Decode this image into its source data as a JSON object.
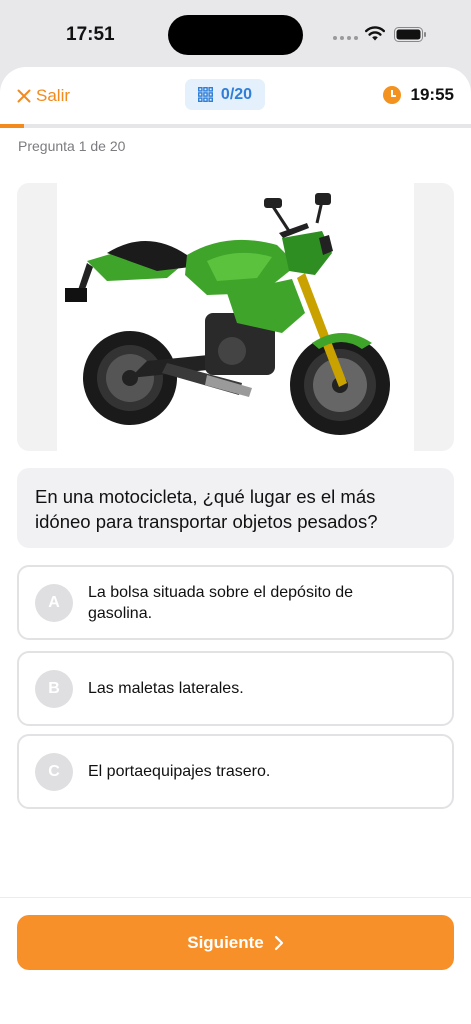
{
  "status_bar": {
    "time": "17:51"
  },
  "header": {
    "exit_label": "Salir",
    "counter": "0/20",
    "timer": "19:55",
    "progress": 0.05
  },
  "question": {
    "index_label": "Pregunta 1 de 20",
    "text": "En una motocicleta, ¿qué lugar es el más idóneo para transportar objetos pesados?"
  },
  "options": [
    {
      "letter": "A",
      "text": "La bolsa situada sobre el depósito de gasolina."
    },
    {
      "letter": "B",
      "text": "Las maletas laterales."
    },
    {
      "letter": "C",
      "text": "El portaequipajes trasero."
    }
  ],
  "footer": {
    "next_label": "Siguiente"
  },
  "colors": {
    "accent": "#f28a1e",
    "counter_blue": "#2f7ed8",
    "bike_green": "#3fa52a"
  }
}
